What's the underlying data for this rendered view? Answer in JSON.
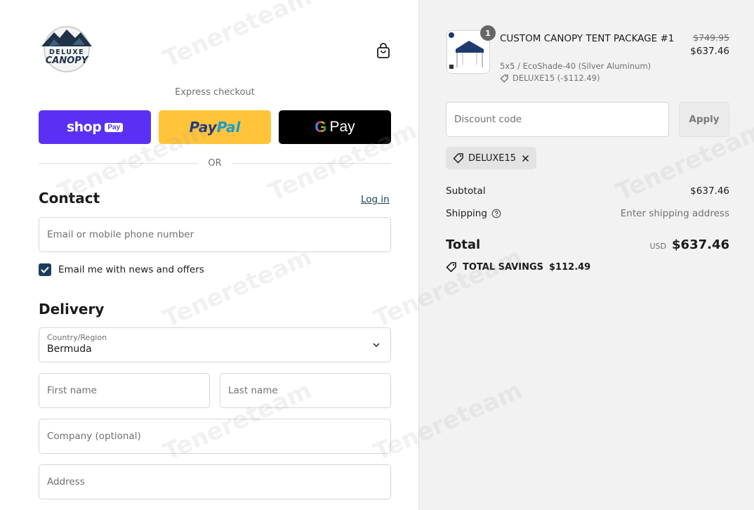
{
  "header": {
    "logo_line1": "DELUXE",
    "logo_line2": "CANOPY"
  },
  "express": {
    "label": "Express checkout",
    "shop_pay": {
      "word": "shop",
      "pill": "Pay"
    },
    "paypal": {
      "part1": "Pay",
      "part2": "Pal"
    },
    "gpay": {
      "g": "G",
      "pay": "Pay"
    },
    "or": "OR"
  },
  "contact": {
    "title": "Contact",
    "login_label": "Log in",
    "email_placeholder": "Email or mobile phone number",
    "newsletter_label": "Email me with news and offers",
    "newsletter_checked": true
  },
  "delivery": {
    "title": "Delivery",
    "country_label": "Country/Region",
    "country_value": "Bermuda",
    "first_name_placeholder": "First name",
    "last_name_placeholder": "Last name",
    "company_placeholder": "Company (optional)",
    "address_placeholder": "Address"
  },
  "summary": {
    "item": {
      "quantity": "1",
      "title": "CUSTOM CANOPY TENT PACKAGE #1",
      "variant": "5x5 / EcoShade-40 (Silver Aluminum)",
      "discount": "DELUXE15 (-$112.49)",
      "price_original": "$749.95",
      "price": "$637.46"
    },
    "discount_placeholder": "Discount code",
    "apply_label": "Apply",
    "applied_code": "DELUXE15",
    "subtotal_label": "Subtotal",
    "subtotal_value": "$637.46",
    "shipping_label": "Shipping",
    "shipping_value": "Enter shipping address",
    "total_label": "Total",
    "currency": "USD",
    "total_value": "$637.46",
    "savings_label": "TOTAL SAVINGS",
    "savings_value": "$112.49"
  },
  "watermark": "Tenereteam",
  "colors": {
    "shop_pay": "#5a31f4",
    "paypal": "#ffc439",
    "gpay": "#000000",
    "accent": "#1a3d5c",
    "summary_bg": "#f2f2f2"
  }
}
